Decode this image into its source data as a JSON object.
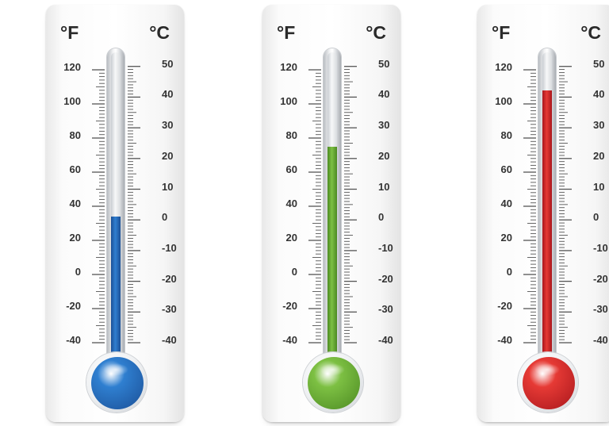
{
  "scale": {
    "fahrenheit_unit": "°F",
    "celsius_unit": "°C",
    "fahrenheit_labels": [
      "120",
      "100",
      "80",
      "60",
      "40",
      "20",
      "0",
      "-20",
      "-40"
    ],
    "celsius_labels": [
      "50",
      "40",
      "30",
      "20",
      "10",
      "0",
      "-10",
      "-20",
      "-30",
      "-40"
    ]
  },
  "thermometers": [
    {
      "id": "blue",
      "color": "#2f7fd0",
      "color_dark": "#1b4f96",
      "reading_fahrenheit": 34
    },
    {
      "id": "green",
      "color": "#7dc043",
      "color_dark": "#4c8a22",
      "reading_fahrenheit": 75
    },
    {
      "id": "red",
      "color": "#e63a35",
      "color_dark": "#a8161c",
      "reading_fahrenheit": 108
    }
  ]
}
